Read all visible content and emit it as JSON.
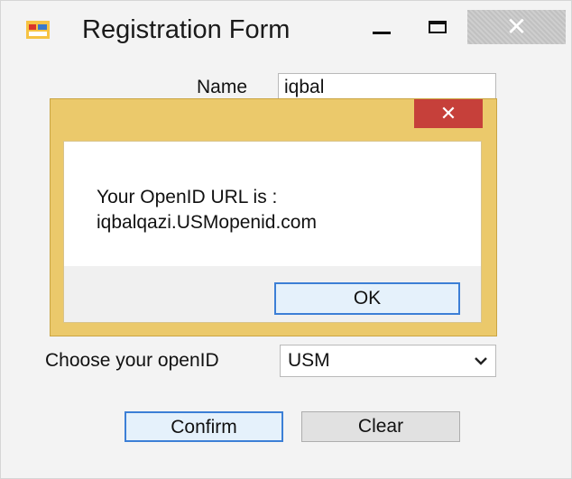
{
  "window": {
    "title": "Registration Form",
    "close_glyph": "✕"
  },
  "form": {
    "name_label": "Name",
    "name_value": "iqbal",
    "openid_label": "Choose your openID",
    "openid_value": "USM",
    "confirm_label": "Confirm",
    "clear_label": "Clear"
  },
  "dialog": {
    "message_line1": "Your OpenID URL is :",
    "message_line2": "iqbalqazi.USMopenid.com",
    "ok_label": "OK",
    "close_glyph": "✕"
  },
  "icons": {
    "app": "form-app-icon",
    "minimize": "minimize-icon",
    "maximize": "maximize-icon",
    "close": "close-icon",
    "dropdown": "chevron-down-icon"
  },
  "colors": {
    "window_bg": "#f3f3f3",
    "dialog_frame": "#ebc96b",
    "dialog_close": "#c6403a",
    "focus_border": "#3c7fd6"
  }
}
